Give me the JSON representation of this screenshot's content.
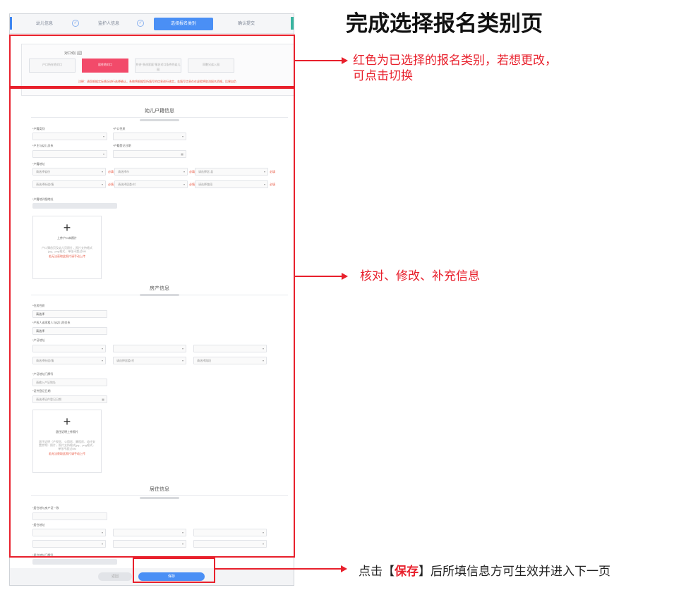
{
  "heading": "完成选择报名类别页",
  "steps": {
    "step1": "幼儿信息",
    "step2": "监护人信息",
    "step3": "选择报名类别",
    "step4": "确认提交",
    "check": "✓"
  },
  "category": {
    "title": "对口幼儿园",
    "options": [
      "户口所在地对口",
      "居住地对口",
      "符合“多孩家庭”报名对口条件的幼儿园",
      "同胞兄弟入园"
    ],
    "note": "注释：请您根据实际情况进行选择确认，系统将根据您所填写的信息进行核实，若填写信息存在虚假将取消报名资格，后果自负"
  },
  "sections": {
    "hukou": "幼儿户籍信息",
    "house": "房产信息",
    "residence": "居住信息"
  },
  "hukou": {
    "type_label": "*户籍类别",
    "nature_label": "*户口性质",
    "relation_label": "*户主与幼儿关系",
    "date_label": "*户籍登记日期",
    "addr_label": "*户籍地址",
    "detail_label": "*户籍地详细地址",
    "province_ph": "请选择省份",
    "city_ph": "请选择市",
    "district_ph": "请选择区/县",
    "street_ph": "请选择街道/镇",
    "community_ph": "请选择居委/村",
    "road_ph": "请选择路段",
    "req": "必填",
    "upload_title": "上传户口本照片",
    "upload_desc": "户口簿首页及幼儿页照片，照片支持格式jpg、png格式，单张不超过5M",
    "upload_link": "若无法获取此照片请手动上传"
  },
  "house": {
    "nature_label": "*住房性质",
    "nature_value": "请选择",
    "relation_label": "*产权人或承租人与幼儿的关系",
    "relation_value": "请选择",
    "addr_label": "*产证地址",
    "street_ph": "请选择街道/镇",
    "community_ph": "请选择居委/村",
    "road_ph": "请选择路段",
    "door_label": "*产证地址门牌号",
    "door_ph": "请输入产证地址",
    "cert_date_label": "*证件登记日期",
    "cert_date_ph": "请选择证件登记日期",
    "upload_title": "居住证明上传照片",
    "upload_desc": "居住证明（产权房、公租房、廉租房、动迁安置房等）照片，照片支持格式jpg、png格式，单张不超过5M",
    "upload_link": "若无法获取此照片请手动上传"
  },
  "residence": {
    "same_label": "*居住地与房产证一致",
    "addr_label": "*居住地址",
    "door_label": "*居住地址门牌号"
  },
  "buttons": {
    "cancel": "返回",
    "save": "保存"
  },
  "annotations": {
    "top_line1": "红色为已选择的报名类别，若想更改，",
    "top_line2": "可点击切换",
    "middle": "核对、修改、补充信息",
    "bottom_pre": "点击【",
    "bottom_save": "保存",
    "bottom_post": "】后所填信息方可生效并进入下一页"
  },
  "colors": {
    "annotation_red": "#e8202c",
    "selected_category": "#f24a6a",
    "primary_blue": "#4a8ff5"
  }
}
